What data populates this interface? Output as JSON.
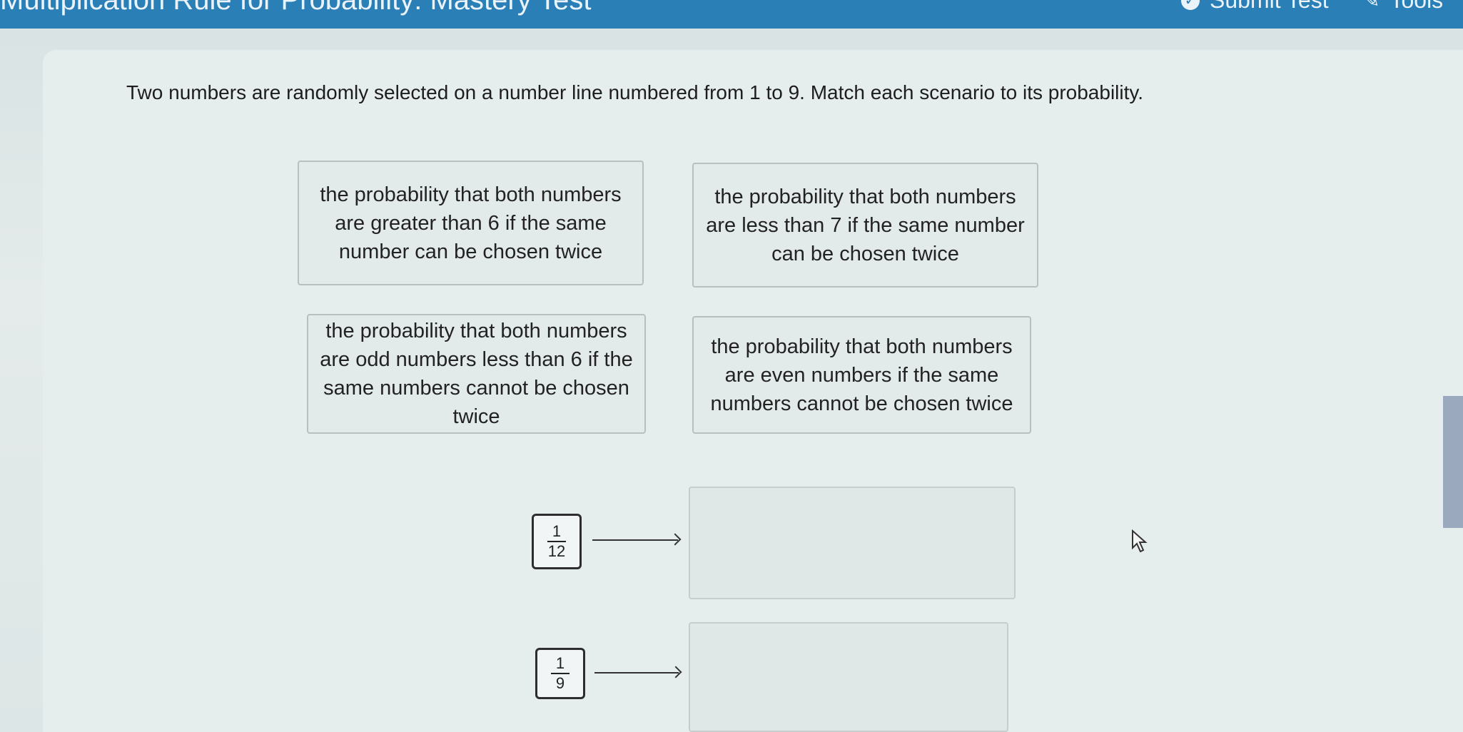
{
  "header": {
    "title": "Multiplication Rule for Probability: Mastery Test",
    "submit_label": "Submit Test",
    "tools_label": "Tools"
  },
  "question": {
    "instructions": "Two numbers are randomly selected on a number line numbered from 1 to 9. Match each scenario to its probability."
  },
  "tiles": [
    {
      "text": "the probability that both numbers are greater than 6 if the same number can be chosen twice"
    },
    {
      "text": "the probability that both numbers are less than 7 if the same number can be chosen twice"
    },
    {
      "text": "the probability that both numbers are odd numbers less than 6 if the same numbers cannot be chosen twice"
    },
    {
      "text": "the probability that both numbers are even numbers if the same numbers cannot be chosen twice"
    }
  ],
  "targets": [
    {
      "numerator": "1",
      "denominator": "12"
    },
    {
      "numerator": "1",
      "denominator": "9"
    }
  ],
  "icons": {
    "submit": "check-circle-icon",
    "tools": "wrench-icon",
    "pointer": "mouse-pointer-icon"
  },
  "colors": {
    "header_bg": "#2a7fb7",
    "scrollbar": "#9aa9bd"
  }
}
